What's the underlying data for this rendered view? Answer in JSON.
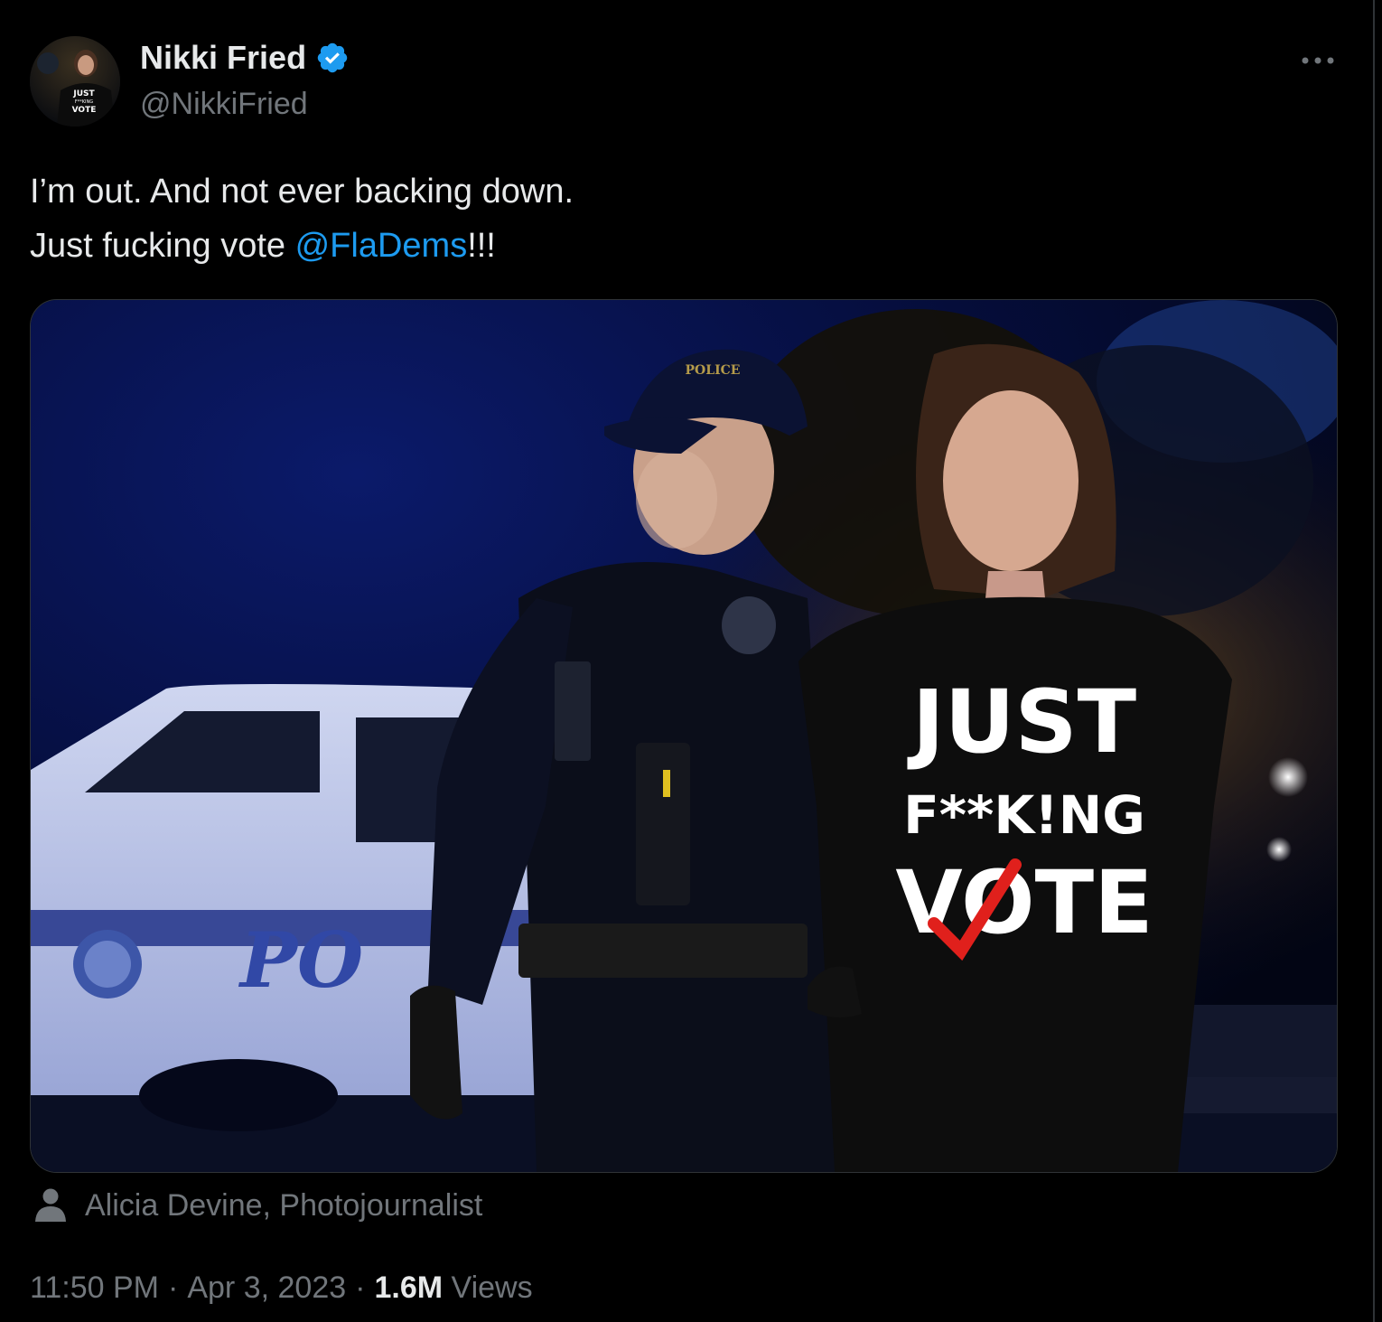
{
  "author": {
    "name": "Nikki Fried",
    "handle": "@NikkiFried",
    "verified": true
  },
  "tweet": {
    "line1": "I’m out. And not ever backing down.",
    "line2_prefix": "Just fucking vote ",
    "mention": "@FlaDems",
    "line2_suffix": "!!!"
  },
  "media": {
    "vehicle_text": "PO",
    "cap_text": "POLICE",
    "shirt_line1": "JUST",
    "shirt_line2": "F**K!NG",
    "shirt_line3": "VOTE"
  },
  "avatar": {
    "shirt_line1": "JUST",
    "shirt_line2": "F**KING",
    "shirt_line3": "VOTE"
  },
  "photo_credit": {
    "icon": "person-icon",
    "label": "Alicia Devine, Photojournalist"
  },
  "meta": {
    "time": "11:50 PM",
    "date": "Apr 3, 2023",
    "separator": "·",
    "views_count": "1.6M",
    "views_label": "Views"
  },
  "icons": {
    "more": "more-horizontal-icon",
    "verified": "verified-badge-icon"
  },
  "colors": {
    "background": "#000000",
    "primary_text": "#e7e9ea",
    "secondary_text": "#71767b",
    "link": "#1d9bf0",
    "verified": "#1d9bf0",
    "border": "#2f3336"
  }
}
